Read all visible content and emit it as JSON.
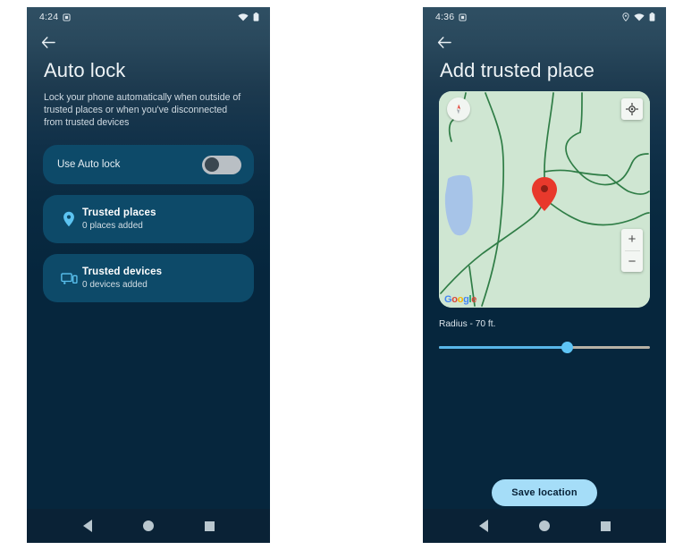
{
  "left_phone": {
    "status_bar": {
      "time": "4:24",
      "icons": [
        "alarm-icon",
        "wifi-icon",
        "battery-icon"
      ]
    },
    "back_icon": "back-arrow-icon",
    "title": "Auto lock",
    "description": "Lock your phone automatically when outside of trusted places or when you've disconnected from trusted devices",
    "toggle": {
      "label": "Use Auto lock",
      "state": "off"
    },
    "items": [
      {
        "icon": "location-pin-icon",
        "title": "Trusted places",
        "subtitle": "0 places added"
      },
      {
        "icon": "devices-icon",
        "title": "Trusted devices",
        "subtitle": "0 devices added"
      }
    ],
    "nav_bar": [
      "back-button",
      "home-button",
      "recents-button"
    ]
  },
  "right_phone": {
    "status_bar": {
      "time": "4:36",
      "icons": [
        "alarm-icon",
        "location-icon",
        "wifi-icon",
        "battery-icon"
      ]
    },
    "back_icon": "back-arrow-icon",
    "title": "Add trusted place",
    "map": {
      "attribution": "Google",
      "marker": "red-map-pin",
      "compass": "compass-icon",
      "locate_button": "my-location-icon",
      "zoom_in": "+",
      "zoom_out": "−"
    },
    "radius": {
      "label": "Radius - 70 ft.",
      "value": 70,
      "unit": "ft.",
      "percent": 61
    },
    "save_button": "Save location",
    "nav_bar": [
      "back-button",
      "home-button",
      "recents-button"
    ]
  },
  "colors": {
    "screen_bg": "#06263d",
    "screen_top": "#2f4f63",
    "card_bg": "#0d4a69",
    "accent": "#5cc4f2",
    "save_btn_bg": "#a5ddf8",
    "map_land": "#cfe6d2",
    "map_road": "#2f7d46",
    "map_water": "#a7c4e8",
    "marker": "#e8392c"
  }
}
